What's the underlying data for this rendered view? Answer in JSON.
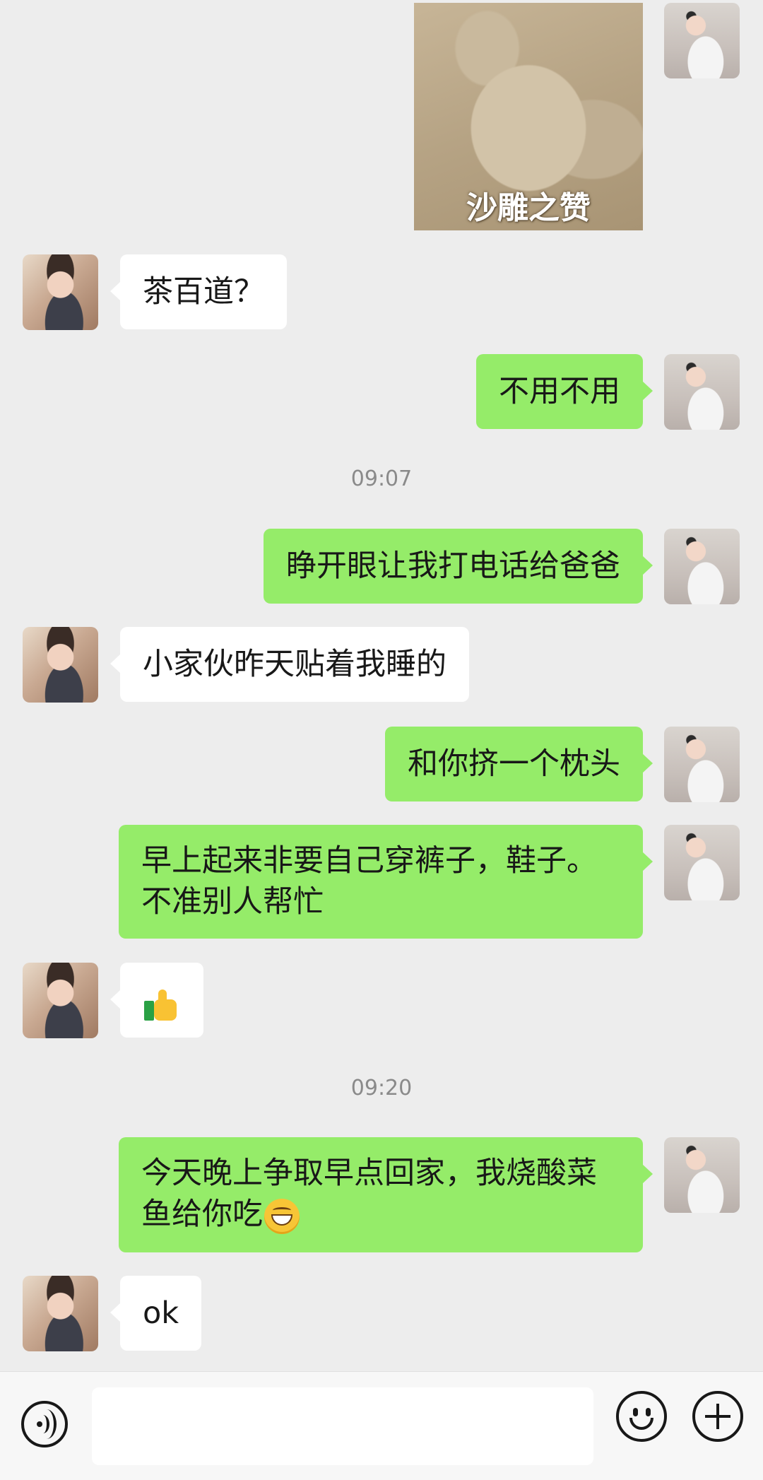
{
  "messages": {
    "sticker_caption": "沙雕之赞",
    "m1": "茶百道？",
    "m2": "不用不用",
    "time1": "09:07",
    "m3": "睁开眼让我打电话给爸爸",
    "m4": "小家伙昨天贴着我睡的",
    "m5": "和你挤一个枕头",
    "m6_line1": "早上起来非要自己穿裤子，鞋子。",
    "m6_line2": "不准别人帮忙",
    "m7_emoji": "thumbs-up-emoji",
    "time2": "09:20",
    "m8_line1": "今天晚上争取早点回家，我烧酸菜",
    "m8_line2": "鱼给你吃",
    "m8_emoji": "grinning-emoji",
    "m9": "ok"
  },
  "colors": {
    "background": "#ededed",
    "my_bubble": "#95ec69",
    "other_bubble": "#ffffff"
  },
  "input_bar": {
    "icons": [
      "voice-icon",
      "emoji-icon",
      "plus-icon"
    ]
  }
}
